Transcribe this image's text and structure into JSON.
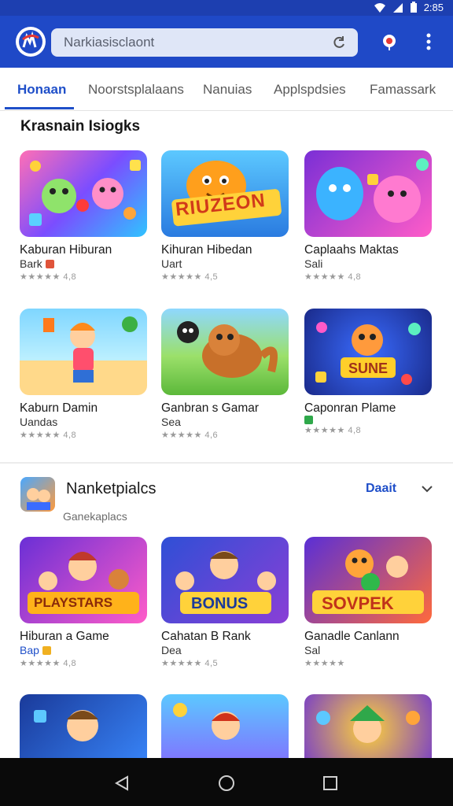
{
  "status": {
    "time": "2:85"
  },
  "appbar": {
    "search_placeholder": "Narkiasisclaont",
    "accent": "#1f49c7"
  },
  "tabs": [
    {
      "label": "Honaan",
      "active": true
    },
    {
      "label": "Noorstsplalaans",
      "active": false
    },
    {
      "label": "Nanuias",
      "active": false
    },
    {
      "label": "Applspdsies",
      "active": false
    },
    {
      "label": "Famassark",
      "active": false
    }
  ],
  "section1": {
    "title": "Krasnain Isiogks",
    "cards": [
      {
        "name": "Kaburan Hiburan",
        "sub": "Bark",
        "rating": "★★★★★ 4,8",
        "tag_color": "#e0543a"
      },
      {
        "name": "Kihuran Hibedan",
        "sub": "Uart",
        "rating": "★★★★★ 4,5",
        "tag_color": ""
      },
      {
        "name": "Caplaahs Maktas",
        "sub": "Sali",
        "rating": "★★★★★ 4,8",
        "tag_color": ""
      },
      {
        "name": "Kaburn Damin",
        "sub": "Uandas",
        "rating": "★★★★★ 4,8",
        "tag_color": ""
      },
      {
        "name": "Ganbran s Gamar",
        "sub": "Sea",
        "rating": "★★★★★ 4,6",
        "tag_color": ""
      },
      {
        "name": "Caponran Plame",
        "sub": "",
        "rating": "★★★★★ 4,8",
        "tag_color": "#2fa84a"
      }
    ]
  },
  "section2": {
    "title": "Nanketpialcs",
    "subtitle": "Ganekaplacs",
    "link": "Daait",
    "cards": [
      {
        "name": "Hiburan a Game",
        "sub": "Bap",
        "rating": "★★★★★ 4,8",
        "tag_color": "#f0b020",
        "banner": "PLAYSTARS"
      },
      {
        "name": "Cahatan B Rank",
        "sub": "Dea",
        "rating": "★★★★★ 4,5",
        "tag_color": "",
        "banner": "BONUS"
      },
      {
        "name": "Ganadle Canlann",
        "sub": "Sal",
        "rating": "★★★★★",
        "tag_color": "",
        "banner": "SOVPEK"
      }
    ]
  },
  "thumb_banners": {
    "t2": "RIUZEON",
    "t6": "SUNE"
  }
}
